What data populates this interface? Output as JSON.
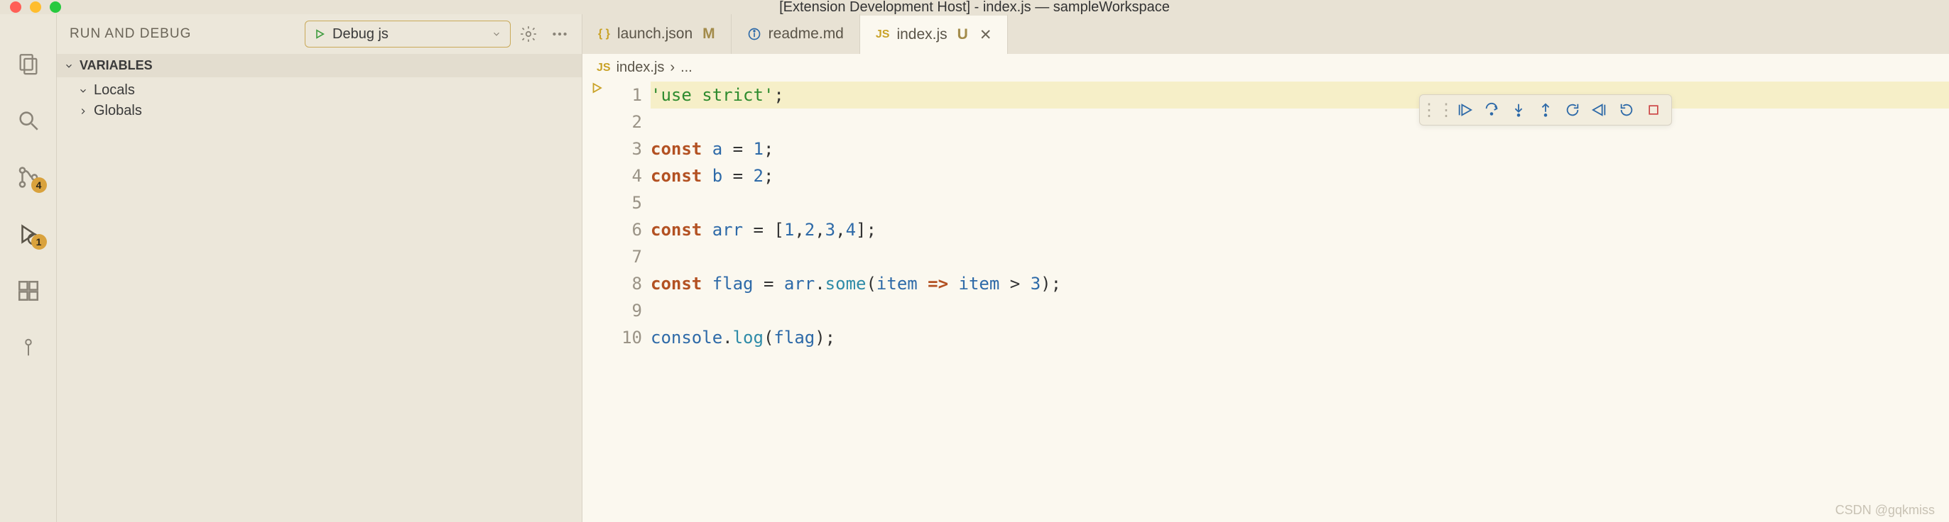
{
  "title": "[Extension Development Host] - index.js — sampleWorkspace",
  "sidebar": {
    "title": "RUN AND DEBUG",
    "config": "Debug js",
    "sections": {
      "variables": "VARIABLES",
      "locals": "Locals",
      "globals": "Globals"
    }
  },
  "activity": {
    "scm_badge": "4",
    "debug_badge": "1"
  },
  "tabs": [
    {
      "icon": "json",
      "name": "launch.json",
      "status": "M",
      "active": false
    },
    {
      "icon": "info",
      "name": "readme.md",
      "status": "",
      "active": false
    },
    {
      "icon": "js",
      "name": "index.js",
      "status": "U",
      "active": true
    }
  ],
  "breadcrumb": {
    "file": "index.js",
    "rest": "..."
  },
  "code": {
    "lines": [
      {
        "n": 1,
        "hl": true,
        "t": [
          [
            "str",
            "'use strict'"
          ],
          [
            "op",
            ";"
          ]
        ]
      },
      {
        "n": 2,
        "hl": false,
        "t": []
      },
      {
        "n": 3,
        "hl": false,
        "t": [
          [
            "kw",
            "const"
          ],
          [
            "op",
            " "
          ],
          [
            "ident",
            "a"
          ],
          [
            "op",
            " = "
          ],
          [
            "num",
            "1"
          ],
          [
            "op",
            ";"
          ]
        ]
      },
      {
        "n": 4,
        "hl": false,
        "t": [
          [
            "kw",
            "const"
          ],
          [
            "op",
            " "
          ],
          [
            "ident",
            "b"
          ],
          [
            "op",
            " = "
          ],
          [
            "num",
            "2"
          ],
          [
            "op",
            ";"
          ]
        ]
      },
      {
        "n": 5,
        "hl": false,
        "t": []
      },
      {
        "n": 6,
        "hl": false,
        "t": [
          [
            "kw",
            "const"
          ],
          [
            "op",
            " "
          ],
          [
            "ident",
            "arr"
          ],
          [
            "op",
            " = ["
          ],
          [
            "num",
            "1"
          ],
          [
            "op",
            ","
          ],
          [
            "num",
            "2"
          ],
          [
            "op",
            ","
          ],
          [
            "num",
            "3"
          ],
          [
            "op",
            ","
          ],
          [
            "num",
            "4"
          ],
          [
            "op",
            "];"
          ]
        ]
      },
      {
        "n": 7,
        "hl": false,
        "t": []
      },
      {
        "n": 8,
        "hl": false,
        "t": [
          [
            "kw",
            "const"
          ],
          [
            "op",
            " "
          ],
          [
            "ident",
            "flag"
          ],
          [
            "op",
            " = "
          ],
          [
            "ident",
            "arr"
          ],
          [
            "op",
            "."
          ],
          [
            "fn",
            "some"
          ],
          [
            "op",
            "("
          ],
          [
            "ident",
            "item"
          ],
          [
            "op",
            " "
          ],
          [
            "arrow",
            "=>"
          ],
          [
            "op",
            " "
          ],
          [
            "ident",
            "item"
          ],
          [
            "op",
            " > "
          ],
          [
            "num",
            "3"
          ],
          [
            "op",
            ");"
          ]
        ]
      },
      {
        "n": 9,
        "hl": false,
        "t": []
      },
      {
        "n": 10,
        "hl": false,
        "t": [
          [
            "ident",
            "console"
          ],
          [
            "op",
            "."
          ],
          [
            "fn",
            "log"
          ],
          [
            "op",
            "("
          ],
          [
            "ident",
            "flag"
          ],
          [
            "op",
            ");"
          ]
        ]
      }
    ]
  },
  "watermark": "CSDN @gqkmiss"
}
